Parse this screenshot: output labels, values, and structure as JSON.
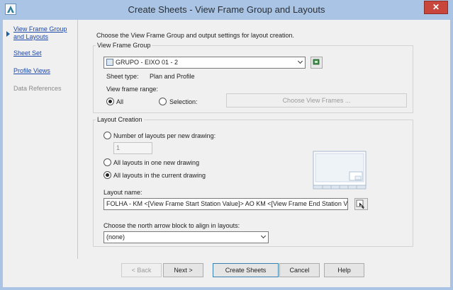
{
  "window": {
    "title": "Create Sheets - View Frame Group and Layouts",
    "close_glyph": "✕",
    "app_icon": "civil3d-app-icon"
  },
  "nav": {
    "items": [
      {
        "label_line1": "View Frame Group",
        "label_line2": "and Layouts",
        "active": true
      },
      {
        "label": "Sheet Set"
      },
      {
        "label": "Profile Views"
      },
      {
        "label": "Data References",
        "disabled": true
      }
    ]
  },
  "main": {
    "intro": "Choose the View Frame Group and output settings for layout creation.",
    "vfg": {
      "group_label": "View Frame Group",
      "selected": "GRUPO - EIXO 01 - 2",
      "sheet_type_label": "Sheet type:",
      "sheet_type_value": "Plan and Profile",
      "range_label": "View frame range:",
      "radio_all": "All",
      "radio_selection": "Selection:",
      "choose_button": "Choose View Frames ..."
    },
    "layout": {
      "group_label": "Layout Creation",
      "opt_number": "Number of layouts per new drawing:",
      "number_value": "1",
      "opt_one_new": "All layouts in one new drawing",
      "opt_current": "All layouts in the current drawing",
      "name_label": "Layout name:",
      "name_value": "FOLHA - KM <[View Frame Start Station Value]> AO KM <[View Frame End Station Valu",
      "north_label": "Choose the north arrow block to align in layouts:",
      "north_value": "(none)"
    }
  },
  "footer": {
    "back": "< Back",
    "next": "Next >",
    "create": "Create Sheets",
    "cancel": "Cancel",
    "help": "Help"
  },
  "colors": {
    "titlebar": "#a9c4e4",
    "link": "#1b47a8",
    "close": "#c8463c"
  }
}
